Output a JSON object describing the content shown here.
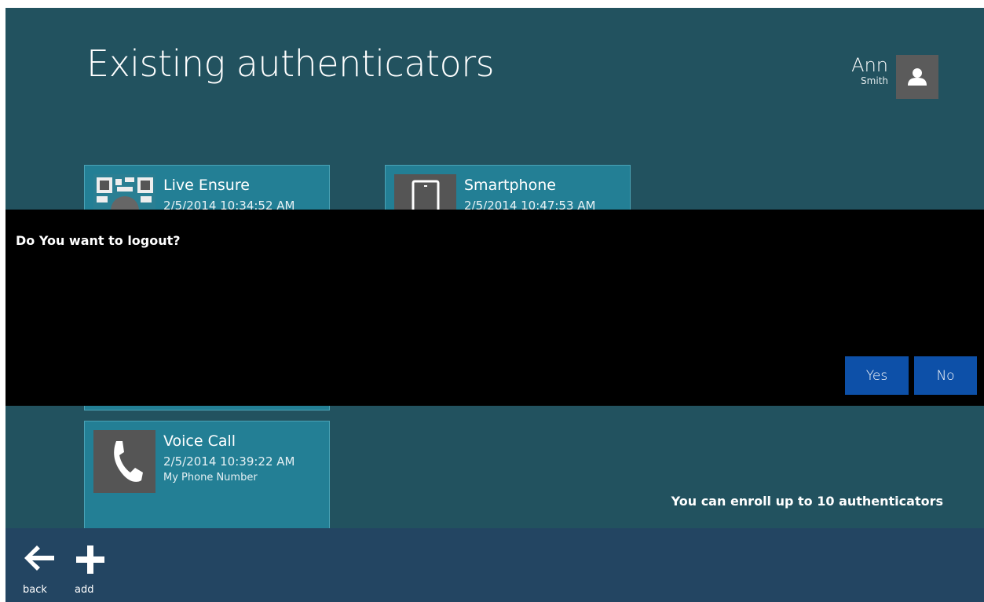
{
  "page": {
    "title": "Existing authenticators"
  },
  "user": {
    "first_name": "Ann",
    "last_name": "Smith",
    "avatar_icon": "person-icon"
  },
  "authenticators": [
    {
      "name": "Live Ensure",
      "date": "2/5/2014 10:34:52 AM",
      "detail": "",
      "icon": "qr-lock-icon"
    },
    {
      "name": "Smartphone",
      "date": "2/5/2014 10:47:53 AM",
      "detail": "",
      "icon": "phone-key-icon"
    },
    {
      "name": "Voice Call",
      "date": "2/5/2014 10:39:22 AM",
      "detail": "My Phone Number",
      "icon": "phone-handset-icon"
    }
  ],
  "enroll_note": "You can enroll up to 10 authenticators",
  "appbar": {
    "back_label": "back",
    "add_label": "add"
  },
  "dialog": {
    "message": "Do You want to logout?",
    "yes_label": "Yes",
    "no_label": "No"
  },
  "colors": {
    "background": "#22525f",
    "tile": "#237f95",
    "appbar": "#234562",
    "dialog": "#000000",
    "dialog_button": "#0d50a8"
  }
}
